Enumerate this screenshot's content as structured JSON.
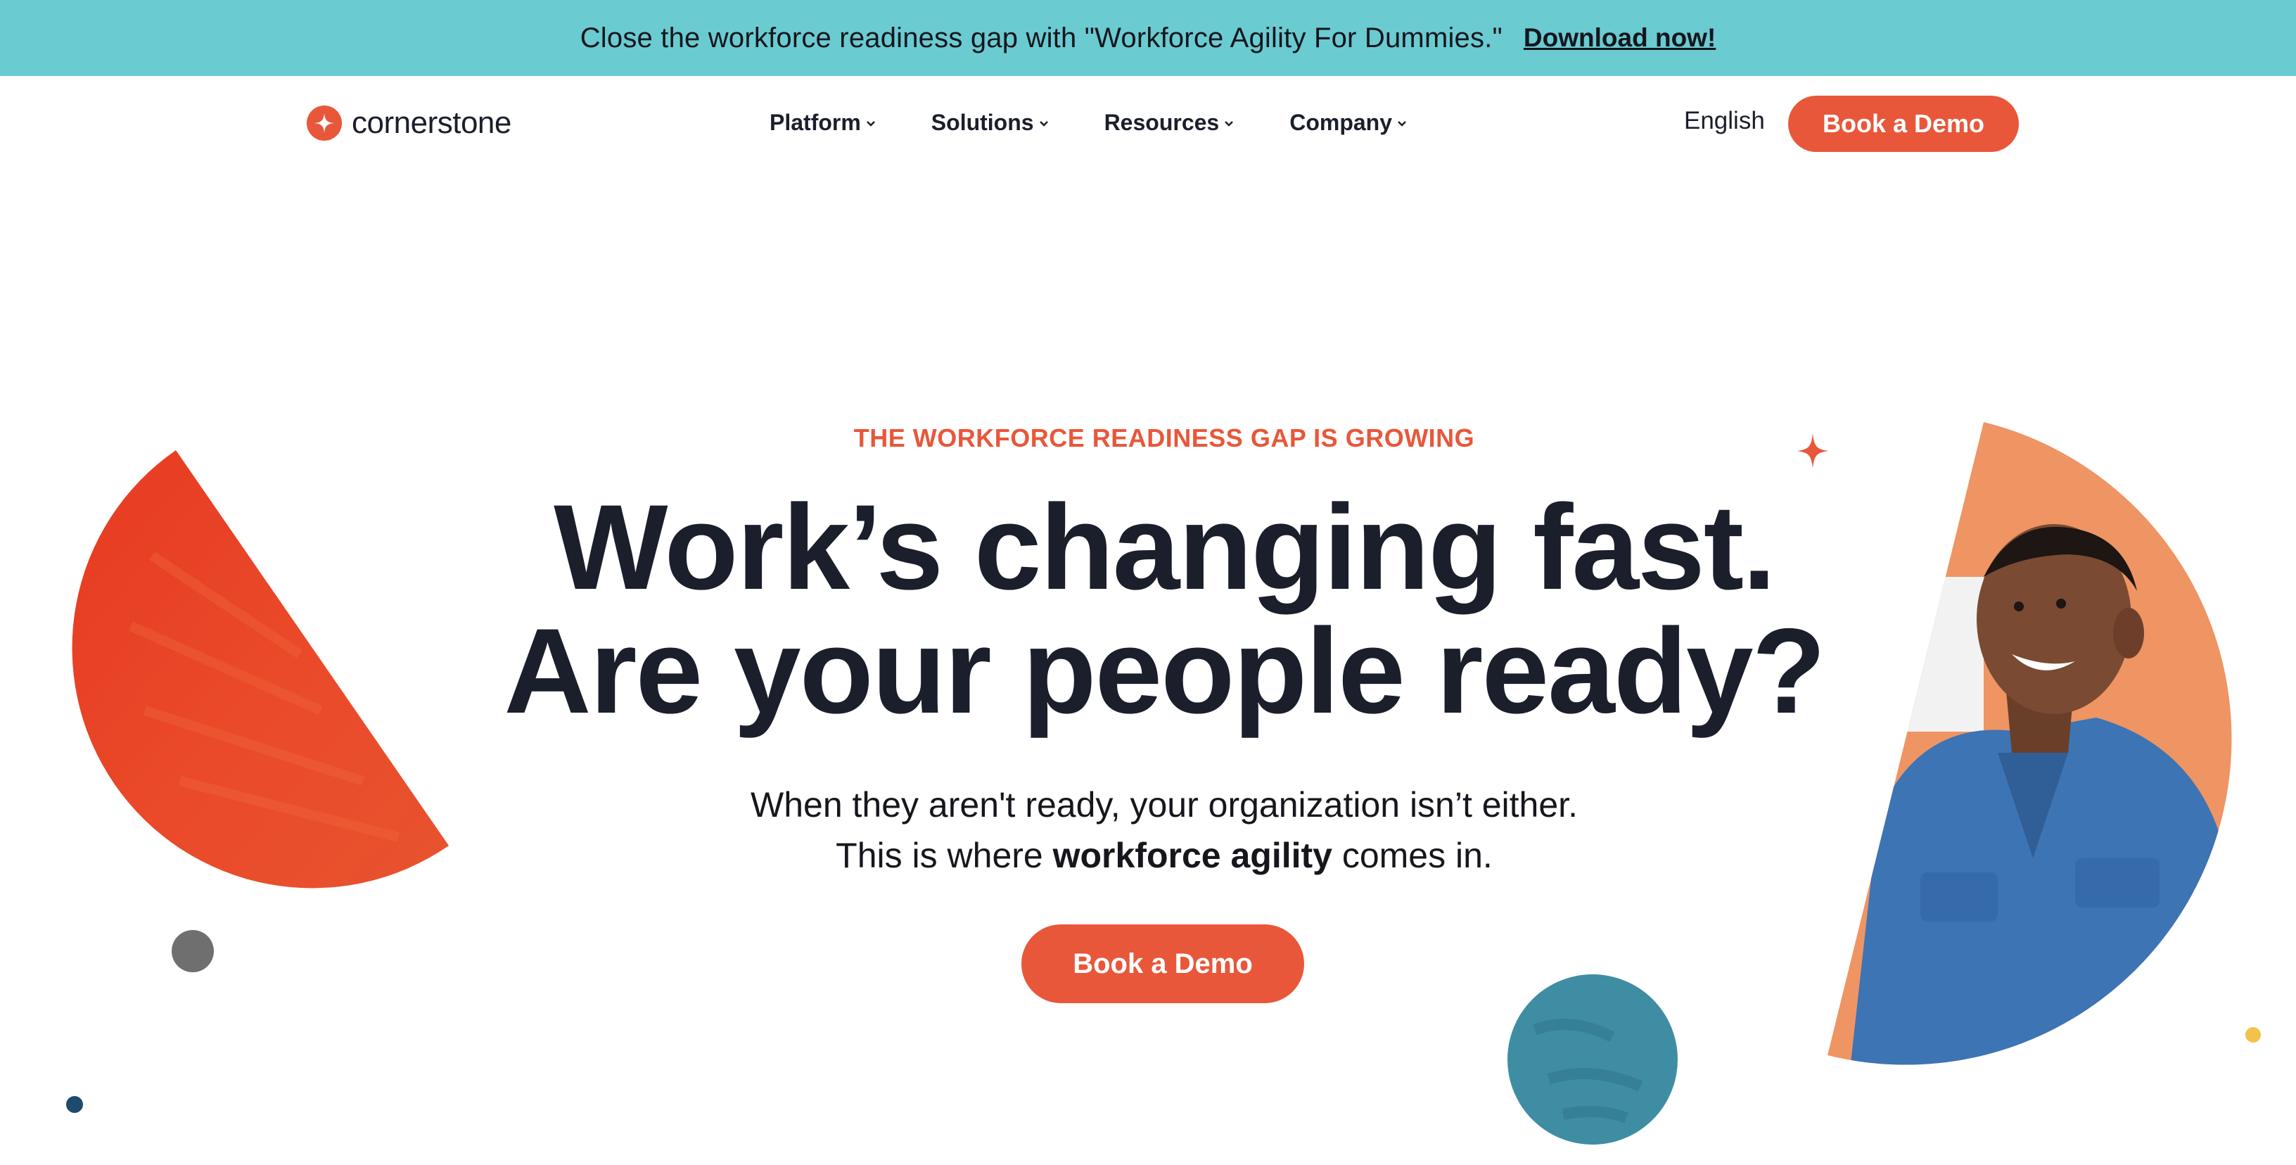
{
  "banner": {
    "text": "Close the workforce readiness gap with \"Workforce Agility For Dummies.\"",
    "link": "Download now!"
  },
  "header": {
    "logo_text": "cornerstone",
    "nav": [
      {
        "label": "Platform"
      },
      {
        "label": "Solutions"
      },
      {
        "label": "Resources"
      },
      {
        "label": "Company"
      }
    ],
    "language": "English",
    "demo_button": "Book a Demo"
  },
  "hero": {
    "eyebrow": "THE WORKFORCE READINESS GAP IS GROWING",
    "headline_1": "Work’s changing fast.",
    "headline_2": "Are your people ready?",
    "sub_1": "When they aren't ready, your organization isn’t either.",
    "sub_2_pre": "This is where ",
    "sub_2_bold": "workforce agility",
    "sub_2_post": " comes in.",
    "cta": "Book a Demo"
  },
  "colors": {
    "banner": "#6acbd1",
    "accent": "#e8573a",
    "text": "#1b1e2b",
    "teal_circle": "#3f8da3",
    "peach": "#ef9463",
    "shirt_blue": "#3d74b3"
  },
  "icons": {
    "logo": "cornerstone-star-icon",
    "nav_chevron": "chevron-down-icon",
    "sparkle": "sparkle-icon"
  }
}
